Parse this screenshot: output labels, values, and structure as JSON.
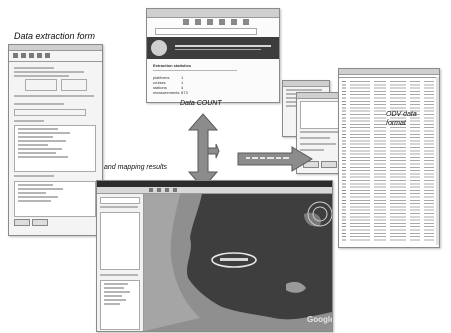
{
  "labels": {
    "form": "Data extraction form",
    "count": "Data COUNT",
    "mapping": "and mapping results",
    "odv": "ODV data\nformat"
  },
  "stats": {
    "heading": "Extraction statistics",
    "rows": [
      {
        "k": "platforms",
        "v": "1"
      },
      {
        "k": "cruises",
        "v": "1"
      },
      {
        "k": "stations",
        "v": "4"
      },
      {
        "k": "measurements",
        "v": "873"
      }
    ]
  },
  "icons": {
    "double_arrow": "up-down-double-arrow",
    "right_arrow": "right-arrow"
  },
  "map": {
    "brand": "Google"
  },
  "colors": {
    "dark_banner": "#3d3d3d",
    "map_sea": "#3e3e3e",
    "map_land": "#8f8f8f",
    "arrow_fill": "#8c8c8c"
  }
}
